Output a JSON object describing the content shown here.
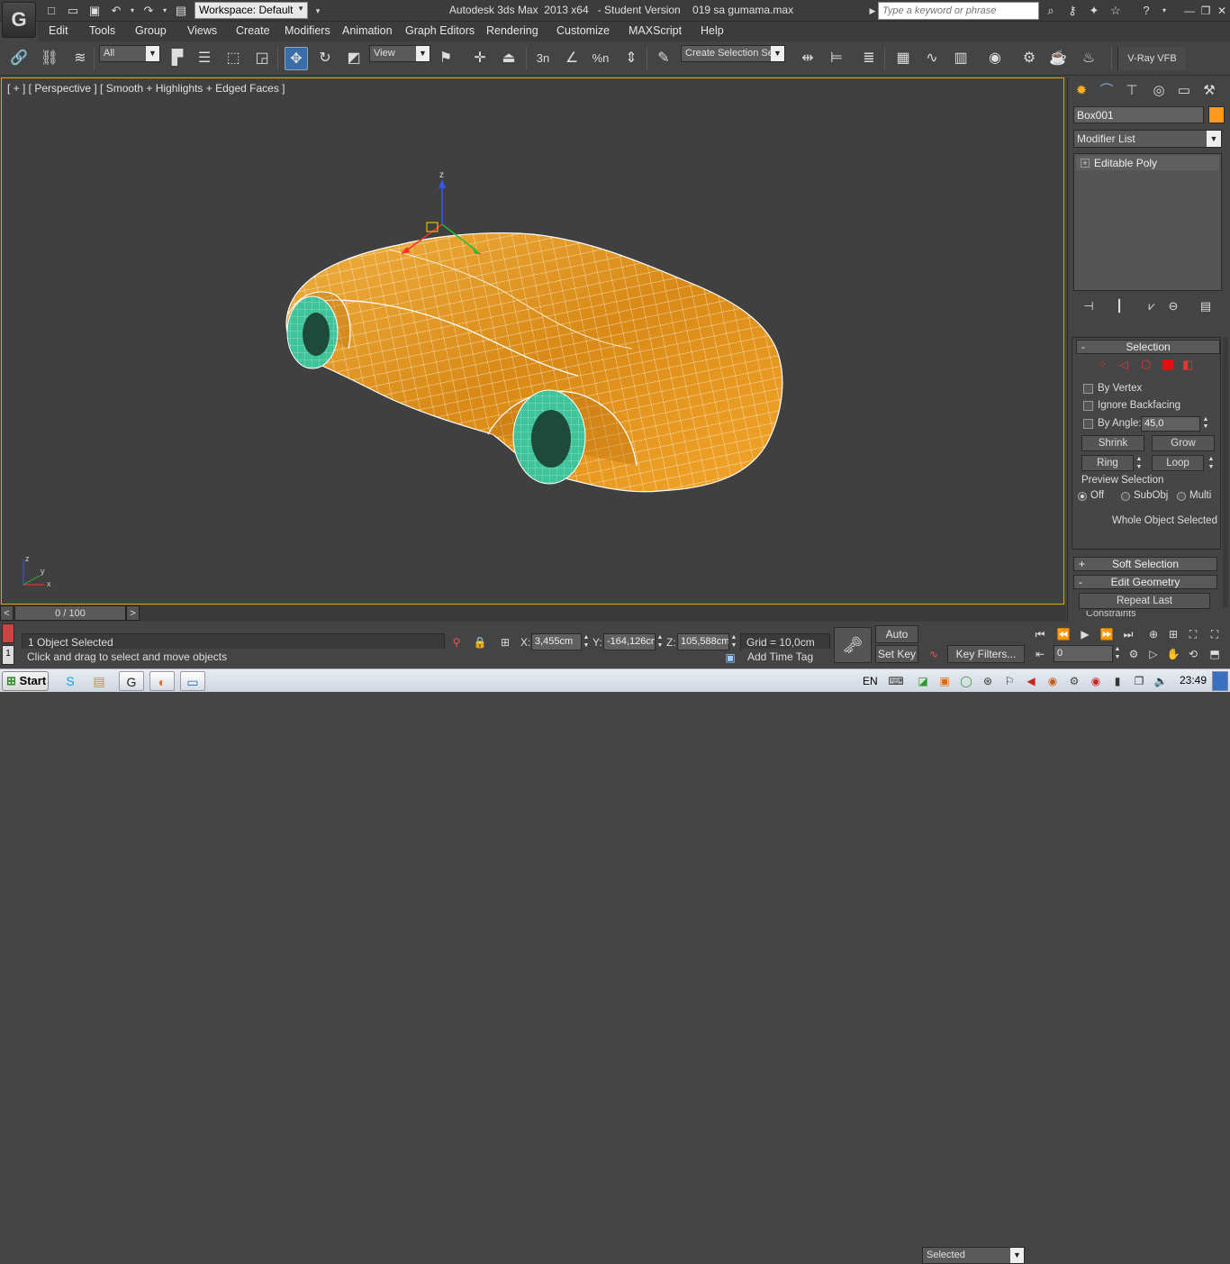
{
  "titlebar": {
    "workspace_label": "Workspace: Default",
    "app_title": "Autodesk 3ds Max  2013 x64   - Student Version    019 sa gumama.max",
    "search_placeholder": "Type a keyword or phrase"
  },
  "menu": [
    "Edit",
    "Tools",
    "Group",
    "Views",
    "Create",
    "Modifiers",
    "Animation",
    "Graph Editors",
    "Rendering",
    "Customize",
    "MAXScript",
    "Help"
  ],
  "toolbar": {
    "filter_value": "All",
    "refcoord_value": "View",
    "selection_set_value": "Create Selection Se",
    "percent_snap_icon": "%n",
    "snap_icon": "3n",
    "vray_vfb": "V-Ray VFB"
  },
  "viewport": {
    "label": "[ + ] [ Perspective ] [ Smooth + Highlights + Edged Faces ]",
    "gizmo_z": "z",
    "axis_z": "z",
    "axis_x": "x",
    "axis_y": "y",
    "car_color": "#e89b2a",
    "wheel_color": "#3fc49a",
    "border_color": "#d9a500"
  },
  "timeline": {
    "prev": "<",
    "position": "0 / 100",
    "next": ">"
  },
  "status": {
    "selected_text": "1 Object Selected",
    "prompt_text": "Click and drag to select and move objects",
    "x_label": "X:",
    "x_value": "3,455cm",
    "y_label": "Y:",
    "y_value": "-164,126cm",
    "z_label": "Z:",
    "z_value": "105,588cm",
    "grid_text": "Grid = 10,0cm",
    "add_time_tag": "Add Time Tag",
    "auto_key": "Auto Key",
    "set_key": "Set Key",
    "key_mode_value": "Selected",
    "key_filters": "Key Filters...",
    "frame_value": "0",
    "maxscript_listener": "1"
  },
  "command_panel": {
    "object_name": "Box001",
    "object_color": "#ff9a1f",
    "modifier_list": "Modifier List",
    "stack_item": "Editable Poly",
    "selection": {
      "title": "Selection",
      "by_vertex": "By Vertex",
      "ignore_backfacing": "Ignore Backfacing",
      "by_angle": "By Angle:",
      "angle_value": "45,0",
      "shrink": "Shrink",
      "grow": "Grow",
      "ring": "Ring",
      "loop": "Loop",
      "preview_selection": "Preview Selection",
      "off": "Off",
      "subobj": "SubObj",
      "multi": "Multi",
      "status": "Whole Object Selected"
    },
    "soft_selection": "Soft Selection",
    "edit_geometry": "Edit Geometry",
    "repeat_last": "Repeat Last",
    "constraints": "Constraints"
  },
  "taskbar": {
    "start": "Start",
    "lang": "EN",
    "clock": "23:49"
  }
}
